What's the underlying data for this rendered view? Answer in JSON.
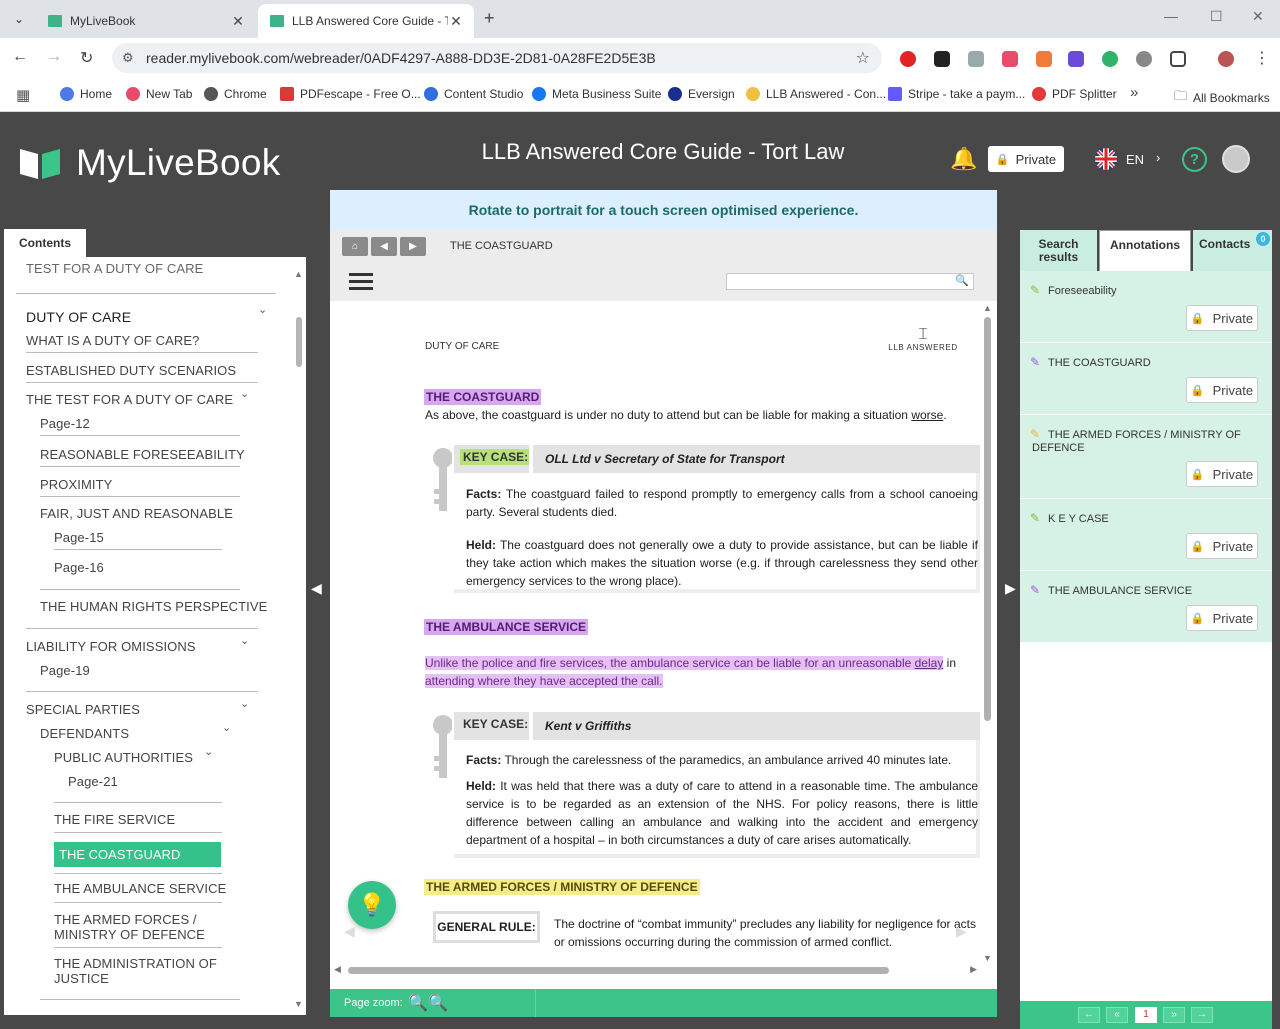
{
  "browser": {
    "tabs": [
      {
        "title": "MyLiveBook"
      },
      {
        "title": "LLB Answered Core Guide - Tort"
      }
    ],
    "url": "reader.mylivebook.com/webreader/0ADF4297-A888-DD3E-2D81-0A28FE2D5E3B",
    "bookmarks": [
      {
        "label": "Home",
        "color": "#4c7be8"
      },
      {
        "label": "New Tab",
        "color": "#e84c6b"
      },
      {
        "label": "Chrome",
        "color": "#555555"
      },
      {
        "label": "PDFescape - Free O...",
        "color": "#d83a3a"
      },
      {
        "label": "Content Studio",
        "color": "#2f6fe0"
      },
      {
        "label": "Meta Business Suite",
        "color": "#1877f2"
      },
      {
        "label": "Eversign",
        "color": "#1b2f8f"
      },
      {
        "label": "LLB Answered - Con...",
        "color": "#f0c040"
      },
      {
        "label": "Stripe - take a paym...",
        "color": "#635bff"
      },
      {
        "label": "PDF Splitter",
        "color": "#e03a3a"
      }
    ],
    "all_bookmarks": "All Bookmarks"
  },
  "app": {
    "logo": "MyLiveBook",
    "title": "LLB Answered Core Guide - Tort Law",
    "private_label": "Private",
    "lang": "EN"
  },
  "contents": {
    "tab_label": "Contents",
    "items": [
      "TEST FOR A DUTY OF CARE",
      "DUTY OF CARE",
      "WHAT IS A DUTY OF CARE?",
      "ESTABLISHED DUTY SCENARIOS",
      "THE TEST FOR A DUTY OF CARE",
      "Page-12",
      "REASONABLE FORESEEABILITY",
      "PROXIMITY",
      "FAIR, JUST AND REASONABLE",
      "Page-15",
      "Page-16",
      "THE HUMAN RIGHTS PERSPECTIVE",
      "LIABILITY FOR OMISSIONS",
      "Page-19",
      "SPECIAL PARTIES",
      "DEFENDANTS",
      "PUBLIC AUTHORITIES",
      "Page-21",
      "THE FIRE SERVICE",
      "THE COASTGUARD",
      "THE AMBULANCE SERVICE",
      "THE ARMED FORCES / MINISTRY OF DEFENCE",
      "THE ADMINISTRATION OF JUSTICE"
    ],
    "armed_l1": "THE ARMED FORCES /",
    "armed_l2": "MINISTRY OF DEFENCE",
    "admin_l1": "THE ADMINISTRATION OF",
    "admin_l2": "JUSTICE"
  },
  "reader": {
    "rotate_notice": "Rotate to portrait for a touch screen optimised experience.",
    "breadcrumb": "THE COASTGUARD",
    "page_header": "DUTY OF CARE",
    "logo_text": "LLB ANSWERED",
    "coastguard": {
      "heading": "THE COASTGUARD",
      "intro_a": "As above, the coastguard is under no duty to attend but can be liable for making a situation ",
      "intro_b": "worse",
      "intro_c": ".",
      "key_label": "KEY CASE:",
      "case": "OLL Ltd v Secretary of State for Transport",
      "facts_label": "Facts:",
      "facts": " The coastguard failed to respond promptly to emergency calls from a school canoeing party. Several students died.",
      "held_label": "Held:",
      "held": " The coastguard does not generally owe a duty to provide assistance, but can be liable if they take action which makes the situation worse (e.g. if through carelessness they send other emergency services to the wrong place)."
    },
    "ambulance": {
      "heading": "THE AMBULANCE SERVICE",
      "text_a": "Unlike the police and fire services, the ambulance service can be liable for an unreasonable ",
      "text_b": "delay",
      "text_c": " in",
      "text_d": "attending where they have accepted the call.",
      "key_label": "KEY CASE:",
      "case": "Kent v Griffiths",
      "facts_label": "Facts:",
      "facts": " Through the carelessness of the paramedics, an ambulance arrived 40 minutes late.",
      "held_label": "Held:",
      "held": " It was held that there was a duty of care to attend in a reasonable time. The ambulance service is to be regarded as an extension of the NHS. For policy reasons, there is little difference between calling an ambulance and walking into the accident and emergency department of a hospital – in both circumstances a duty of care arises automatically."
    },
    "armed": {
      "heading": "THE ARMED FORCES / MINISTRY OF DEFENCE",
      "rule_label": "GENERAL RULE:",
      "rule": "The doctrine of “combat immunity” precludes any liability for negligence for acts or omissions occurring during the commission of armed conflict."
    },
    "zoom_label": "Page zoom:"
  },
  "annotations": {
    "tabs": [
      "Search results",
      "Annotations",
      "Contacts"
    ],
    "tab_search_l1": "Search",
    "tab_search_l2": "results",
    "contacts_badge": "0",
    "items": [
      {
        "title": "Foreseeability",
        "color": "#7bc043",
        "button": "Private"
      },
      {
        "title": "THE COASTGUARD",
        "color": "#a35bd8",
        "button": "Private"
      },
      {
        "title": "THE ARMED FORCES / MINISTRY OF DEFENCE",
        "color": "#e8b923",
        "button": "Private"
      },
      {
        "title": "K E Y CASE",
        "color": "#7bc043",
        "button": "Private"
      },
      {
        "title": "THE AMBULANCE SERVICE",
        "color": "#a35bd8",
        "button": "Private"
      }
    ],
    "armed_l1": "THE ARMED FORCES / MINISTRY OF",
    "armed_l2": "DEFENCE",
    "pager": {
      "current": "1"
    }
  }
}
